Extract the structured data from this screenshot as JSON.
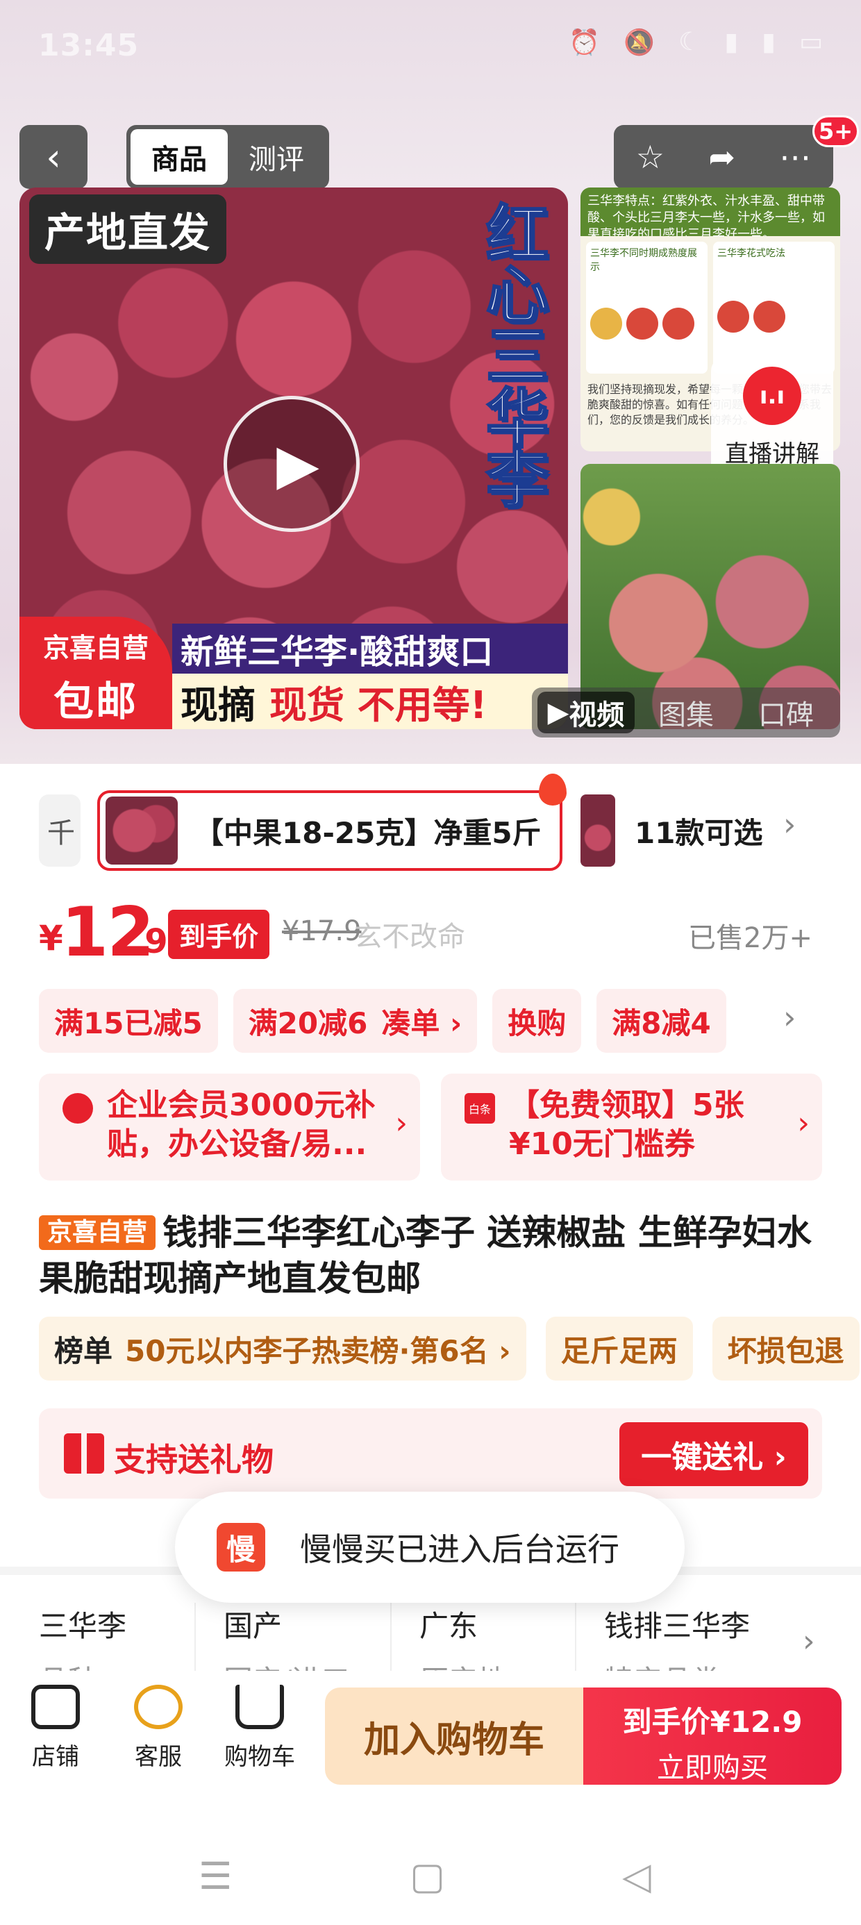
{
  "status": {
    "time": "13:45",
    "icons": [
      "alarm-icon",
      "mute-icon",
      "moon-icon",
      "5g-icon",
      "5g-icon",
      "battery-icon"
    ]
  },
  "nav": {
    "tabs": [
      "商品",
      "测评"
    ],
    "active_tab": 0,
    "badge": "5+"
  },
  "hero": {
    "origin_chip": "产地直发",
    "vertical_title": "红心三华李",
    "jx_top": "京喜自营",
    "jx_bottom": "包邮",
    "banner1": "新鲜三华李·酸甜爽口",
    "banner2_plain": "现摘",
    "banner2_red": "现货 不用等!",
    "info_header": "三华李特点：红紫外衣、汁水丰盈、甜中带酸、个头比三月李大一些，汁水多一些，如果直接吃的口感比三月李好一些。",
    "info_col1": "三华李不同时期成熟度展示",
    "info_col2": "三华李花式吃法",
    "info_footer": "我们坚持现摘现发，希望每一颗果子都能为您带去脆爽酸甜的惊喜。如有任何问题，请随时联系我们，您的反馈是我们成长的养分。",
    "live_label": "直播讲解",
    "media_tabs": [
      "视频",
      "图集",
      "口碑"
    ]
  },
  "variant": {
    "prev": "千",
    "selected": "【中果18-25克】净重5斤",
    "count": "11款可选"
  },
  "price": {
    "yen": "¥",
    "int": "12",
    "dec": ".9",
    "tag": "到手价",
    "original": "¥17.9",
    "watermark": "玄不改命",
    "sold": "已售2万+"
  },
  "promos": [
    {
      "text": "满15已减5"
    },
    {
      "text": "满20减6",
      "sub": "凑单 ›"
    },
    {
      "text": "换购"
    },
    {
      "text": "满8减4"
    }
  ],
  "coupons": [
    {
      "line": "企业会员3000元补贴，办公设备/易..."
    },
    {
      "line": "【免费领取】5张¥10无门槛券",
      "icon_text": "白条"
    }
  ],
  "title": {
    "badge": "京喜自营",
    "text": "钱排三华李红心李子 送辣椒盐 生鲜孕妇水果脆甜现摘产地直发包邮"
  },
  "tags": {
    "rank_label": "榜单",
    "rank_text": "50元以内李子热卖榜·第6名 ›",
    "t2": "足斤足两",
    "t3": "坏损包退"
  },
  "gift": {
    "label": "支持送礼物",
    "button": "一键送礼 ›"
  },
  "toast": {
    "icon": "慢",
    "text": "慢慢买已进入后台运行"
  },
  "specs": [
    {
      "value": "三华李",
      "key": "品种"
    },
    {
      "value": "国产",
      "key": "国产/进口"
    },
    {
      "value": "广东",
      "key": "原产地"
    },
    {
      "value": "钱排三华李",
      "key": "特产品类"
    }
  ],
  "bottombar": {
    "shop": "店铺",
    "service": "客服",
    "cart": "购物车",
    "add_cart": "加入购物车",
    "buy_price": "到手价¥12.9",
    "buy_now": "立即购买"
  }
}
